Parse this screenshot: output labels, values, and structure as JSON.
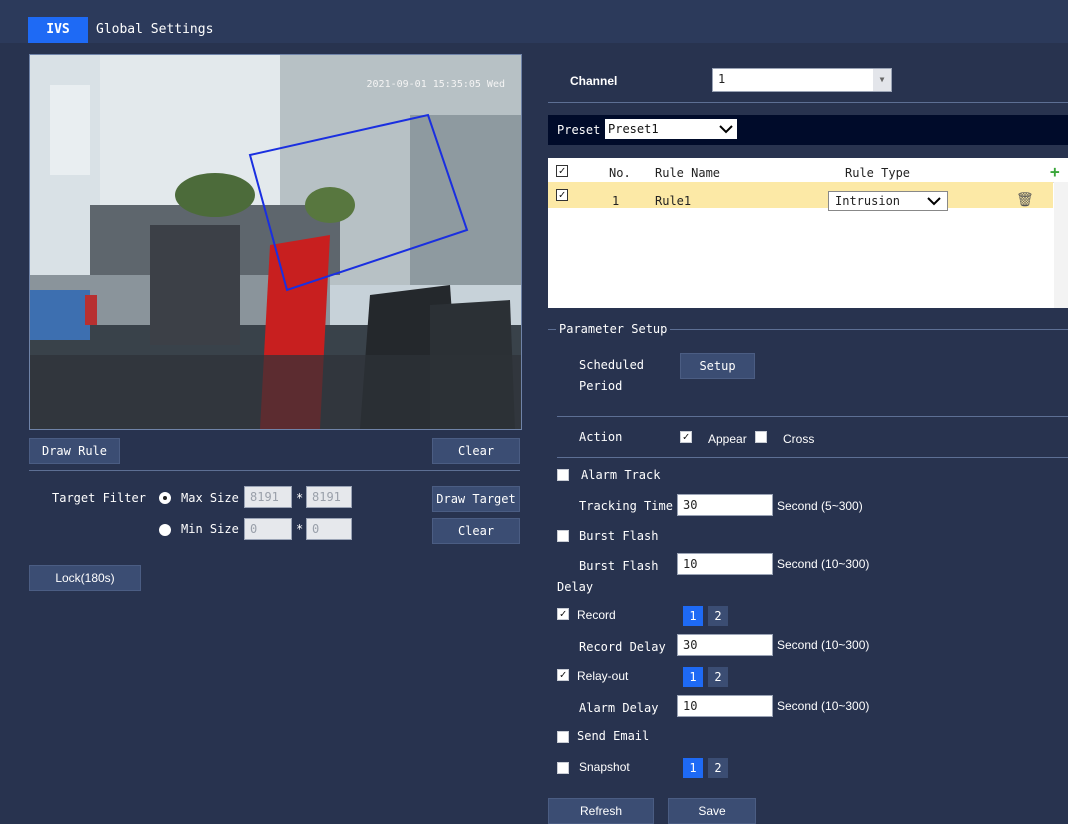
{
  "tabs": {
    "ivs": "IVS",
    "global": "Global Settings"
  },
  "video": {
    "timestamp": "2021-09-01 15:35:05 Wed"
  },
  "left": {
    "draw_rule": "Draw Rule",
    "clear": "Clear",
    "target_filter_label": "Target Filter",
    "max_size_label": "Max Size",
    "min_size_label": "Min Size",
    "max_w": "8191",
    "max_h": "8191",
    "min_w": "0",
    "min_h": "0",
    "times": "*",
    "draw_target": "Draw Target",
    "clear2": "Clear",
    "lock": "Lock(180s)"
  },
  "channel": {
    "label": "Channel",
    "value": "1"
  },
  "preset": {
    "label": "Preset",
    "value": "Preset1"
  },
  "rules_table": {
    "headers": {
      "no": "No.",
      "name": "Rule Name",
      "type": "Rule Type"
    },
    "rows": [
      {
        "no": "1",
        "name": "Rule1",
        "type": "Intrusion"
      }
    ]
  },
  "params": {
    "section_title": "Parameter Setup",
    "scheduled_label_1": "Scheduled",
    "scheduled_label_2": "Period",
    "setup_btn": "Setup",
    "action_label": "Action",
    "appear": "Appear",
    "cross": "Cross",
    "alarm_track": "Alarm Track",
    "tracking_time_label": "Tracking Time",
    "tracking_time": "30",
    "tracking_unit": "Second (5~300)",
    "burst_flash": "Burst Flash",
    "burst_delay_label_1": "Burst Flash",
    "burst_delay_label_2": "Delay",
    "burst_delay": "10",
    "burst_unit": "Second (10~300)",
    "record": "Record",
    "record_delay_label": "Record Delay",
    "record_delay": "30",
    "record_unit": "Second (10~300)",
    "relay_out": "Relay-out",
    "alarm_delay_label": "Alarm Delay",
    "alarm_delay": "10",
    "alarm_unit": "Second (10~300)",
    "send_email": "Send Email",
    "snapshot": "Snapshot",
    "chip1": "1",
    "chip2": "2"
  },
  "footer": {
    "refresh": "Refresh",
    "save": "Save"
  },
  "colors": {
    "accent": "#1e6af5",
    "selected_row": "#fce9a6",
    "background": "#28334f"
  }
}
